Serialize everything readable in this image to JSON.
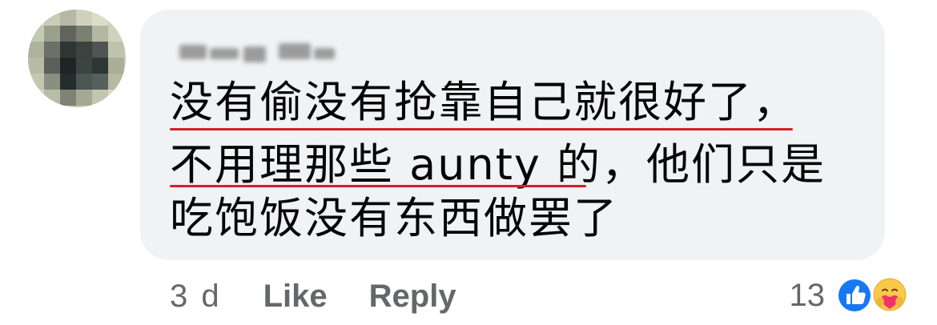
{
  "comment": {
    "lines": [
      "没有偷没有抢靠自己就很好了，",
      "不用理那些 aunty 的，他们只是",
      "吃饱饭没有东西做罢了"
    ]
  },
  "actions": {
    "time": "3 d",
    "like_label": "Like",
    "reply_label": "Reply"
  },
  "reactions": {
    "count": "13",
    "types": [
      "like-icon",
      "care-icon"
    ]
  },
  "colors": {
    "bubble": "#f0f2f5",
    "underline": "#d61f26",
    "like_blue": "#1877f2",
    "muted_text": "#65676b"
  }
}
